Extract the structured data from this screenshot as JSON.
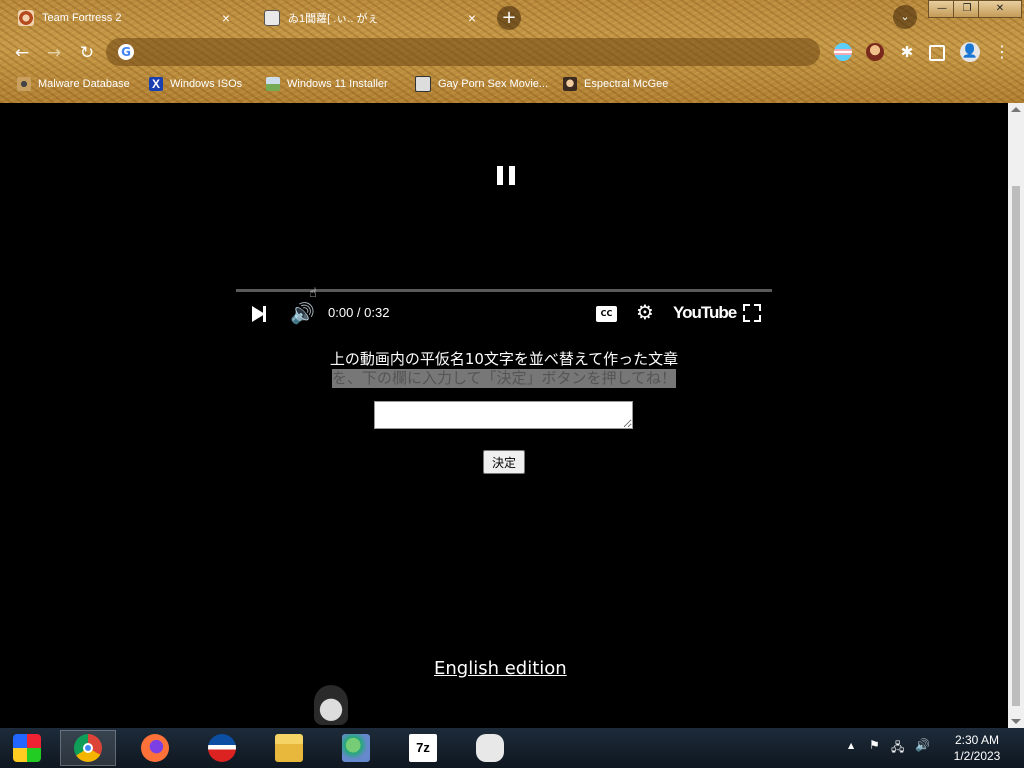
{
  "browser": {
    "tabs": [
      {
        "title": "Team Fortress 2",
        "close": "×"
      },
      {
        "title": "ゐ1聞蘿[ .ぃ.. がぇ",
        "close": "×"
      }
    ],
    "new_tab": "+",
    "tab_search": "⌄",
    "window_controls": {
      "minimize": "—",
      "maximize": "❐",
      "close": "✕"
    },
    "nav": {
      "back": "←",
      "forward": "→",
      "reload": "↻"
    },
    "omnibox": {
      "value": "",
      "engine_glyph": "G"
    },
    "extensions": {
      "puzzle": "✱",
      "profile": "👤",
      "menu": "⋮"
    },
    "bookmarks": [
      {
        "label": "Malware Database"
      },
      {
        "label": "Windows ISOs",
        "glyph": "X"
      },
      {
        "label": "Windows 11 Installer"
      },
      {
        "label": "Gay Porn Sex Movie..."
      },
      {
        "label": "Espectral McGee"
      }
    ]
  },
  "video": {
    "state": "paused",
    "progress": 0.0,
    "time": "0:00 / 0:32",
    "cc_label": "CC",
    "settings_glyph": "⚙",
    "volume_glyph": "🔊",
    "brand": "YouTube"
  },
  "page": {
    "instruction_line1": "上の動画内の平仮名10文字を並べ替えて作った文章",
    "instruction_line2": "を、下の欄に入力して「決定」ボタンを押してね！",
    "answer_value": "",
    "submit_label": "決定",
    "english_link": "English edition"
  },
  "taskbar": {
    "apps": [
      "start",
      "chrome",
      "firefox",
      "obama",
      "explorer",
      "network",
      "7zip",
      "gamepad"
    ],
    "sevenzip_label": "7z",
    "tray": {
      "arrow": "▲",
      "flag": "⚑",
      "network": "🖧",
      "volume": "🔊"
    },
    "clock_time": "2:30 AM",
    "clock_date": "1/2/2023"
  },
  "colors": {
    "chrome_theme": "#c59a48",
    "page_background": "#000000",
    "progress_played": "#ff0000",
    "taskbar": "#162230"
  }
}
